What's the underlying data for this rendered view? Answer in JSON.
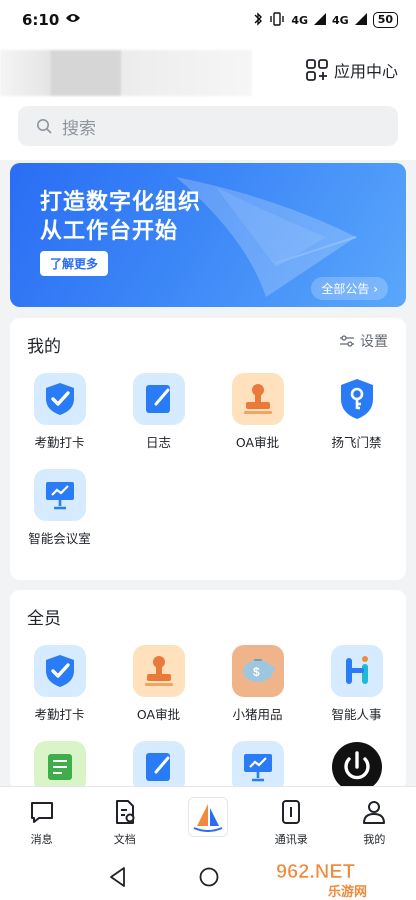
{
  "status_bar": {
    "time": "6:10",
    "signal_1": "4G",
    "signal_2": "4G",
    "battery": "50"
  },
  "header": {
    "app_center_label": "应用中心"
  },
  "search": {
    "placeholder": "搜索"
  },
  "banner": {
    "title_line1": "打造数字化组织",
    "title_line2": "从工作台开始",
    "learn_more": "了解更多",
    "all_announcements": "全部公告 ›"
  },
  "mine": {
    "title": "我的",
    "settings_label": "设置",
    "apps": [
      {
        "label": "考勤打卡",
        "icon": "checkin-shield-icon",
        "bg": "#d6ebff"
      },
      {
        "label": "日志",
        "icon": "notebook-pen-icon",
        "bg": "#d6ebff"
      },
      {
        "label": "OA审批",
        "icon": "stamp-icon",
        "bg": "#ffe2bd"
      },
      {
        "label": "扬飞门禁",
        "icon": "key-shield-icon",
        "bg": "#ffffff"
      },
      {
        "label": "智能会议室",
        "icon": "presentation-board-icon",
        "bg": "#d6ebff"
      }
    ]
  },
  "all_staff": {
    "title": "全员",
    "apps": [
      {
        "label": "考勤打卡",
        "icon": "checkin-shield-icon",
        "bg": "#d6ebff"
      },
      {
        "label": "OA审批",
        "icon": "stamp-icon",
        "bg": "#ffe2bd"
      },
      {
        "label": "小猪用品",
        "icon": "piggy-bank-icon",
        "bg": "#f0b48a"
      },
      {
        "label": "智能人事",
        "icon": "hr-h-icon",
        "bg": "#d6ebff"
      },
      {
        "label": "",
        "icon": "scroll-icon",
        "bg": "#d9f5c8"
      },
      {
        "label": "",
        "icon": "notebook-pen-icon",
        "bg": "#d6ebff"
      },
      {
        "label": "",
        "icon": "presentation-board-icon",
        "bg": "#d6ebff"
      },
      {
        "label": "",
        "icon": "power-icon",
        "bg": "#ffffff"
      }
    ]
  },
  "tabbar": {
    "tabs": [
      {
        "label": "消息",
        "icon": "message-icon"
      },
      {
        "label": "文档",
        "icon": "document-icon"
      },
      {
        "label": "",
        "icon": "sailboat-logo-icon"
      },
      {
        "label": "通讯录",
        "icon": "contacts-icon"
      },
      {
        "label": "我的",
        "icon": "profile-icon"
      }
    ]
  },
  "watermark": {
    "text_top": "962.NET",
    "text_bottom": "乐游网"
  },
  "colors": {
    "primary": "#2a6df4",
    "background": "#f2f3f5",
    "orange": "#f08a3c"
  }
}
